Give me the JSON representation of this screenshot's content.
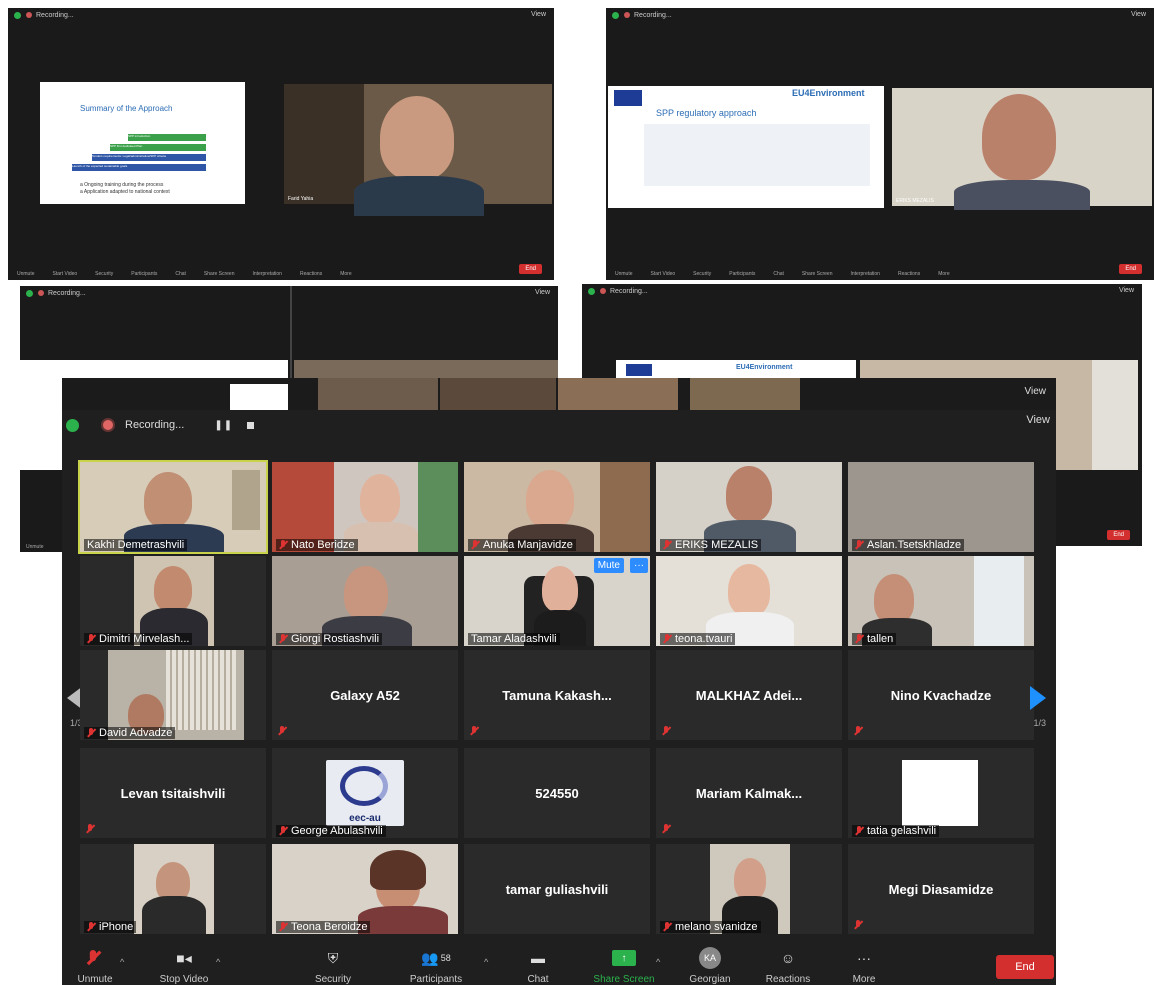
{
  "windows": {
    "w1": {
      "recording": "Recording...",
      "view": "View",
      "slide_title": "Summary of the Approach",
      "slide_items": [
        "SPP introduction",
        "SPP first dedicated Plan",
        "Tenders requirements: Legal/administrative/SPP criteria",
        "Launch of the expected sustainable goals"
      ],
      "slide_tail": [
        "a Ongoing training during the process",
        "a Application adapted to national context"
      ],
      "cam_label": "Farid Yahia",
      "toolbar": [
        "Unmute",
        "Start Video",
        "Security",
        "Participants",
        "Chat",
        "Share Screen",
        "Interpretation",
        "Reactions",
        "More"
      ],
      "end": "End"
    },
    "w2": {
      "recording": "Recording...",
      "view": "View",
      "brand": "EU4Environment",
      "slide_title": "SPP regulatory approach",
      "cam_label": "ERIKS MEZALIS",
      "toolbar": [
        "Unmute",
        "Start Video",
        "Security",
        "Participants",
        "Chat",
        "Share Screen",
        "Interpretation",
        "Reactions",
        "More"
      ],
      "end": "End"
    },
    "w3": {
      "recording": "Recording...",
      "view": "View",
      "toolbar": [
        "Unmute"
      ]
    },
    "w4": {
      "recording": "Recording...",
      "view": "View",
      "brand": "EU4Environment",
      "end": "End"
    }
  },
  "main": {
    "recording": "Recording...",
    "view_back": "View",
    "view": "View",
    "page_left": "1/3",
    "page_right": "1/3",
    "mute_label": "Mute",
    "more_label": "···",
    "tiles": [
      {
        "name": "Kakhi Demetrashvili",
        "type": "video"
      },
      {
        "name": "Nato Beridze",
        "type": "video"
      },
      {
        "name": "Anuka Manjavidze",
        "type": "video"
      },
      {
        "name": "ERIKS MEZALIS",
        "type": "video"
      },
      {
        "name": "Aslan.Tsetskhladze",
        "type": "video"
      },
      {
        "name": "Dimitri Mirvelash...",
        "type": "video"
      },
      {
        "name": "Giorgi Rostiashvili",
        "type": "video"
      },
      {
        "name": "Tamar Aladashvili",
        "type": "video"
      },
      {
        "name": "teona.tvauri",
        "type": "video"
      },
      {
        "name": "tallen",
        "type": "video"
      },
      {
        "name": "David Advadze",
        "type": "video"
      },
      {
        "name": "Galaxy A52",
        "type": "text"
      },
      {
        "name": "Tamuna Kakash...",
        "type": "text"
      },
      {
        "name": "MALKHAZ Adei...",
        "type": "text"
      },
      {
        "name": "Nino Kvachadze",
        "type": "text"
      },
      {
        "name": "Levan tsitaishvili",
        "type": "text"
      },
      {
        "name": "George Abulashvili",
        "type": "video"
      },
      {
        "name": "524550",
        "type": "text"
      },
      {
        "name": "Mariam Kalmak...",
        "type": "text"
      },
      {
        "name": "tatia gelashvili",
        "type": "video"
      },
      {
        "name": "iPhone",
        "type": "video"
      },
      {
        "name": "Teona Beroidze",
        "type": "video"
      },
      {
        "name": "tamar guliashvili",
        "type": "text"
      },
      {
        "name": "melano svanidze",
        "type": "video"
      },
      {
        "name": "Megi Diasamidze",
        "type": "text"
      }
    ],
    "eec_logo": "eec-au",
    "toolbar": {
      "unmute": "Unmute",
      "stop_video": "Stop Video",
      "security": "Security",
      "participants": "Participants",
      "participants_count": "58",
      "chat": "Chat",
      "share_screen": "Share Screen",
      "ka": "KA",
      "georgian": "Georgian",
      "reactions": "Reactions",
      "more": "More",
      "end": "End"
    }
  }
}
